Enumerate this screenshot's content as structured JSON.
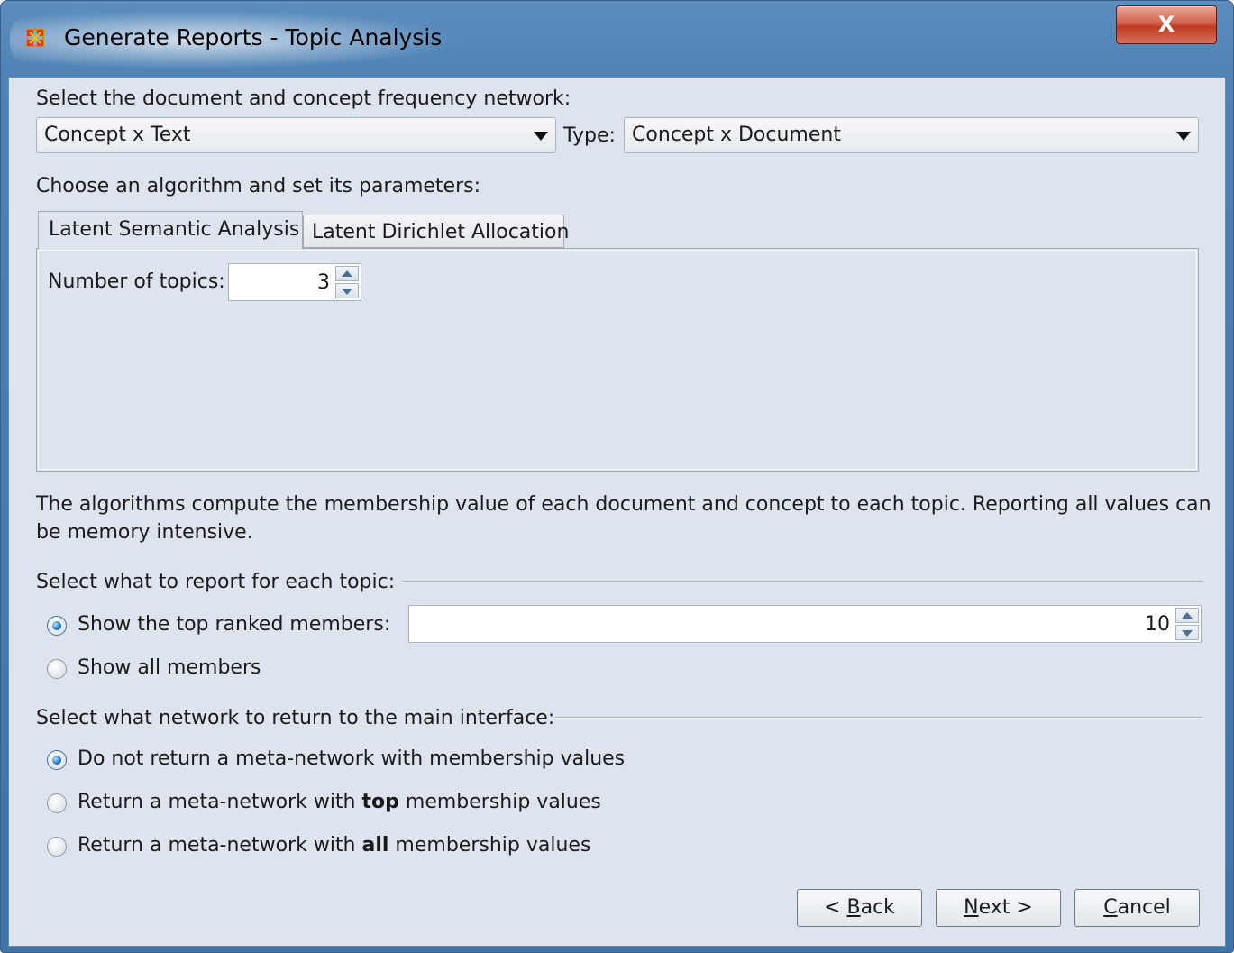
{
  "window": {
    "title": "Generate Reports - Topic Analysis",
    "close_label": "X"
  },
  "network_select": {
    "label": "Select the document and concept frequency network:",
    "network_value": "Concept x Text",
    "type_label": "Type:",
    "type_value": "Concept x Document"
  },
  "algorithm": {
    "label": "Choose an algorithm and set its parameters:",
    "tabs": [
      {
        "label": "Latent Semantic Analysis",
        "selected": true
      },
      {
        "label": "Latent Dirichlet Allocation",
        "selected": false
      }
    ],
    "topics_label": "Number of topics:",
    "topics_value": "3"
  },
  "info_text_line1": "The algorithms compute the membership value of each document and concept to each topic. Reporting all values can",
  "info_text_line2": "be memory intensive.",
  "report_section": {
    "label": "Select what to report for each topic:",
    "options": [
      {
        "label": "Show the top ranked members:",
        "selected": true
      },
      {
        "label": "Show all members",
        "selected": false
      }
    ],
    "top_count": "10"
  },
  "return_section": {
    "label": "Select what network to return to the main interface:",
    "options": [
      {
        "label": "Do not return a meta-network with membership values",
        "selected": true
      },
      {
        "pre": "Return a meta-network with ",
        "bold": "top",
        "post": " membership values",
        "selected": false
      },
      {
        "pre": "Return a meta-network with ",
        "bold": "all",
        "post": " membership values",
        "selected": false
      }
    ]
  },
  "buttons": {
    "back_pre": "< ",
    "back_mnemonic": "B",
    "back_post": "ack",
    "next_mnemonic": "N",
    "next_post": "ext >",
    "cancel_mnemonic": "C",
    "cancel_post": "ancel"
  }
}
